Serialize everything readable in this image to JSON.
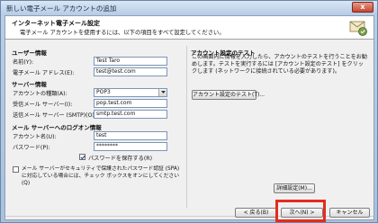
{
  "window": {
    "title": "新しい電子メール アカウントの追加",
    "close": "x"
  },
  "header": {
    "title": "インターネット電子メール設定",
    "subtitle": "電子メール アカウントを使用するには、以下の項目をすべて設定してください。"
  },
  "user_info": {
    "heading": "ユーザー情報",
    "name_label": "名前(Y):",
    "name_value": "Test Taro",
    "email_label": "電子メール アドレス(E):",
    "email_value": "test@test.com"
  },
  "server_info": {
    "heading": "サーバー情報",
    "account_type_label": "アカウントの種類(A):",
    "account_type_value": "POP3",
    "incoming_label": "受信メール サーバー(I):",
    "incoming_value": "pop.test.com",
    "outgoing_label": "送信メール サーバー (SMTP)(O):",
    "outgoing_value": "smtp.test.com"
  },
  "logon_info": {
    "heading": "メール サーバーへのログオン情報",
    "account_name_label": "アカウント名(U):",
    "account_name_value": "test",
    "password_label": "パスワード(P):",
    "password_value": "********",
    "remember_password_label": "パスワードを保存する(R)",
    "remember_password_checked": true,
    "spa_label": "メール サーバーがセキュリティで保護されたパスワード認証 (SPA) に対応している場合には、チェック ボックスをオンにしてください(Q)",
    "spa_checked": false
  },
  "test_settings": {
    "heading": "アカウント設定のテスト",
    "description": "この画面内に情報を入力したら、アカウントのテストを行うことをお勧めします。テストを実行するには [アカウント設定のテスト] をクリックします (ネットワークに接続されている必要があります)。",
    "test_button": "アカウント設定のテスト(T)..."
  },
  "buttons": {
    "more_settings": "詳細設定(M)...",
    "back": "< 戻る(B)",
    "next": "次へ(N) >",
    "cancel": "キャンセル"
  },
  "colors": {
    "highlight": "#e22c1f"
  }
}
